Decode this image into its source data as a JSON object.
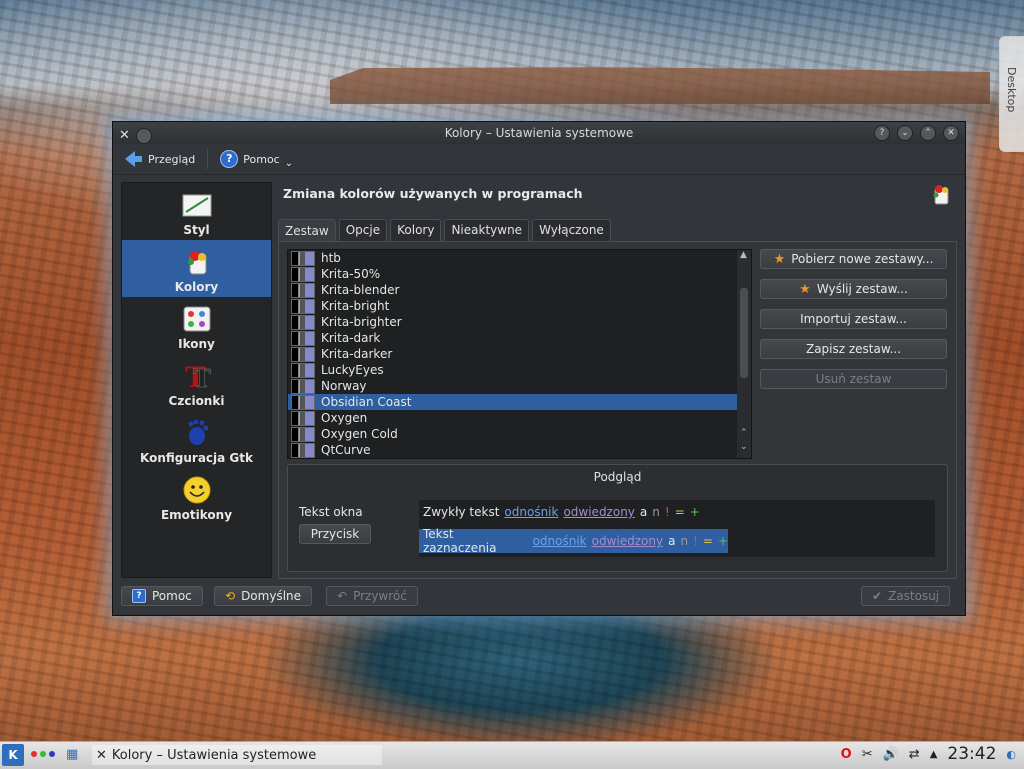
{
  "desktop": {
    "tab_label": "Desktop"
  },
  "window": {
    "title": "Kolory – Ustawienia systemowe",
    "toolbar": {
      "back_label": "Przegląd",
      "help_label": "Pomoc"
    }
  },
  "sidebar": {
    "items": [
      {
        "label": "Styl"
      },
      {
        "label": "Kolory"
      },
      {
        "label": "Ikony"
      },
      {
        "label": "Czcionki"
      },
      {
        "label": "Konfiguracja Gtk"
      },
      {
        "label": "Emotikony"
      }
    ]
  },
  "content": {
    "title": "Zmiana kolorów używanych w programach",
    "tabs": [
      "Zestaw",
      "Opcje",
      "Kolory",
      "Nieaktywne",
      "Wyłączone"
    ],
    "schemes": [
      "htb",
      "Krita-50%",
      "Krita-blender",
      "Krita-bright",
      "Krita-brighter",
      "Krita-dark",
      "Krita-darker",
      "LuckyEyes",
      "Norway",
      "Obsidian Coast",
      "Oxygen",
      "Oxygen Cold",
      "QtCurve"
    ],
    "selected_scheme": "Obsidian Coast",
    "buttons": {
      "get_new": "Pobierz nowe zestawy...",
      "upload": "Wyślij zestaw...",
      "import": "Importuj zestaw...",
      "save": "Zapisz zestaw...",
      "remove": "Usuń zestaw"
    },
    "preview": {
      "title": "Podgląd",
      "window_text": "Tekst okna",
      "button": "Przycisk",
      "normal_text": "Zwykły tekst",
      "selection_text": "Tekst zaznaczenia",
      "link": "odnośnik",
      "visited": "odwiedzony",
      "active": "a",
      "inactive": "n",
      "negative": "!",
      "neutral": "=",
      "positive": "+"
    }
  },
  "bottom": {
    "help": "Pomoc",
    "defaults": "Domyślne",
    "reset": "Przywróć",
    "apply": "Zastosuj"
  },
  "taskbar": {
    "task_title": "Kolory – Ustawienia systemowe",
    "clock": "23:42"
  }
}
